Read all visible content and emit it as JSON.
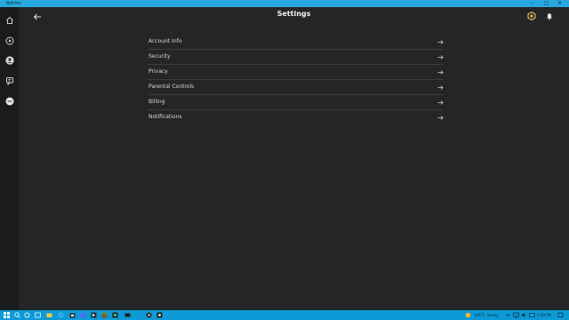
{
  "window": {
    "title": "Roblox"
  },
  "header": {
    "title": "Settings"
  },
  "settings_items": [
    {
      "label": "Account Info"
    },
    {
      "label": "Security"
    },
    {
      "label": "Privacy"
    },
    {
      "label": "Parental Controls"
    },
    {
      "label": "Billing"
    },
    {
      "label": "Notifications"
    }
  ],
  "sidebar": {
    "items": [
      {
        "icon": "home-icon"
      },
      {
        "icon": "play-icon"
      },
      {
        "icon": "avatar-icon"
      },
      {
        "icon": "chat-icon"
      },
      {
        "icon": "more-icon"
      }
    ]
  },
  "taskbar": {
    "weather": "135°F",
    "weather_desc": "Sunny",
    "time": "5:29 PM"
  },
  "colors": {
    "background": "#232527",
    "sidebar": "#191b1d",
    "titlebar": "#27a9df",
    "taskbar": "#0e9ad6",
    "robux_accent": "#e6b74d"
  }
}
